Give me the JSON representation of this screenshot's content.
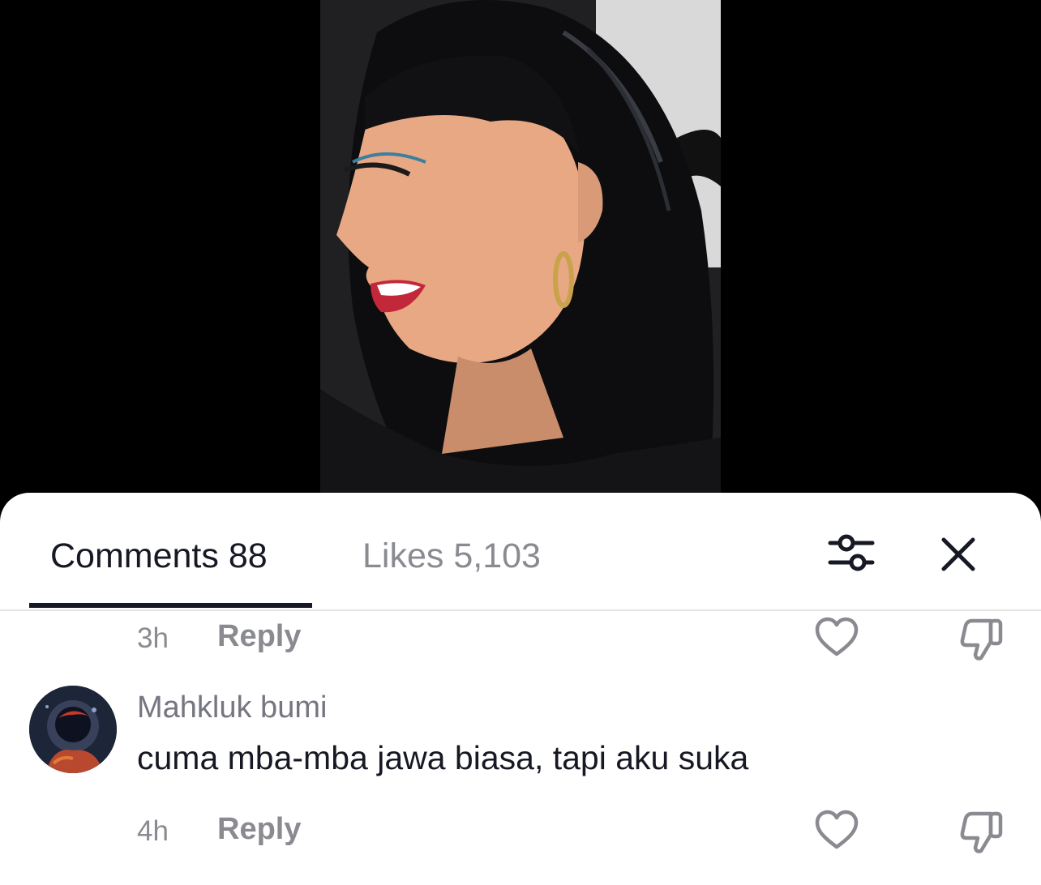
{
  "tabs": {
    "comments_label": "Comments 88",
    "likes_label": "Likes 5,103"
  },
  "icons": {
    "filter": "sliders-icon",
    "close": "close-icon",
    "like": "heart-icon",
    "dislike": "thumbs-down-icon"
  },
  "comments": [
    {
      "time": "3h",
      "reply_label": "Reply"
    },
    {
      "username": "Mahkluk bumi",
      "text": "cuma mba-mba jawa biasa, tapi aku suka",
      "time": "4h",
      "reply_label": "Reply"
    }
  ],
  "colors": {
    "primary_text": "#161823",
    "secondary_text": "#8a8b91",
    "sheet_bg": "#ffffff",
    "video_bg": "#000000"
  }
}
